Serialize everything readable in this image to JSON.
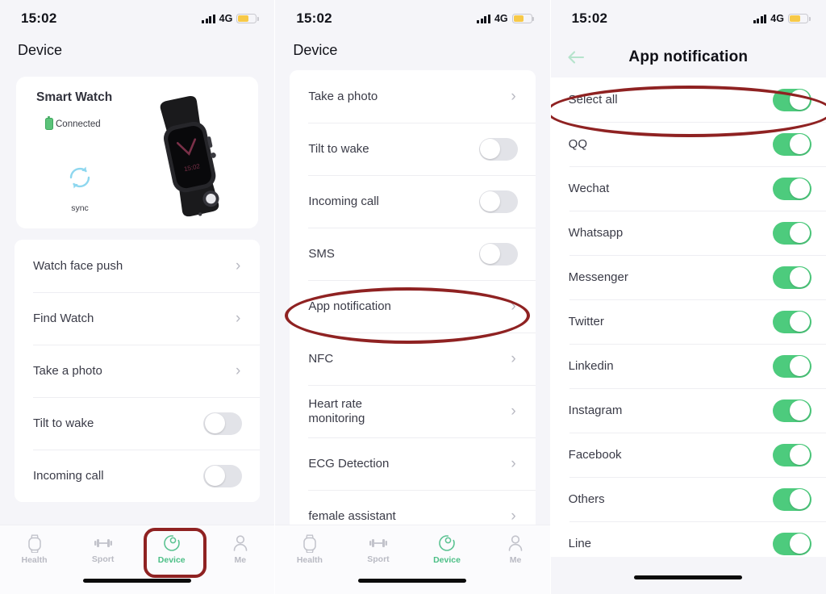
{
  "status_bar": {
    "time": "15:02",
    "network": "4G",
    "signal_icon": "signal-bars-icon",
    "battery_icon": "battery-low-power-icon"
  },
  "panel1": {
    "nav_title": "Device",
    "device_card": {
      "name": "Smart Watch",
      "connection_status": "Connected",
      "connection_icon": "battery-green-icon",
      "sync_label": "sync",
      "sync_icon": "sync-refresh-icon",
      "watch_image": "smart-watch-photo"
    },
    "rows": [
      {
        "label": "Watch face push",
        "type": "chevron"
      },
      {
        "label": "Find Watch",
        "type": "chevron"
      },
      {
        "label": "Take a photo",
        "type": "chevron"
      },
      {
        "label": "Tilt to wake",
        "type": "toggle",
        "on": false
      },
      {
        "label": "Incoming call",
        "type": "toggle",
        "on": false
      }
    ]
  },
  "panel2": {
    "nav_title": "Device",
    "rows": [
      {
        "label": "Take a photo",
        "type": "chevron"
      },
      {
        "label": "Tilt to wake",
        "type": "toggle",
        "on": false
      },
      {
        "label": "Incoming call",
        "type": "toggle",
        "on": false
      },
      {
        "label": "SMS",
        "type": "toggle",
        "on": false
      },
      {
        "label": "App notification",
        "type": "chevron",
        "highlighted": true
      },
      {
        "label": "NFC",
        "type": "chevron"
      },
      {
        "label": "Heart rate monitoring",
        "type": "chevron"
      },
      {
        "label": "ECG Detection",
        "type": "chevron"
      },
      {
        "label": "female assistant",
        "type": "chevron"
      }
    ]
  },
  "panel3": {
    "title": "App notification",
    "back_icon": "back-arrow-icon",
    "rows": [
      {
        "label": "Select all",
        "on": true,
        "highlighted": true
      },
      {
        "label": "QQ",
        "on": true
      },
      {
        "label": "Wechat",
        "on": true
      },
      {
        "label": "Whatsapp",
        "on": true
      },
      {
        "label": "Messenger",
        "on": true
      },
      {
        "label": "Twitter",
        "on": true
      },
      {
        "label": "Linkedin",
        "on": true
      },
      {
        "label": "Instagram",
        "on": true
      },
      {
        "label": "Facebook",
        "on": true
      },
      {
        "label": "Others",
        "on": true
      },
      {
        "label": "Line",
        "on": true
      }
    ]
  },
  "tab_bar": {
    "items": [
      {
        "label": "Health",
        "icon": "watch-icon",
        "active": false
      },
      {
        "label": "Sport",
        "icon": "dumbbell-icon",
        "active": false
      },
      {
        "label": "Device",
        "icon": "device-ring-icon",
        "active": true
      },
      {
        "label": "Me",
        "icon": "person-icon",
        "active": false
      }
    ]
  },
  "colors": {
    "toggle_on": "#4dcb7d",
    "toggle_off": "#e2e3e8",
    "accent_green": "#4cbf86",
    "annotation_red": "#8f2222",
    "battery_yellow": "#f7c948",
    "panel_bg": "#f5f5f9"
  }
}
